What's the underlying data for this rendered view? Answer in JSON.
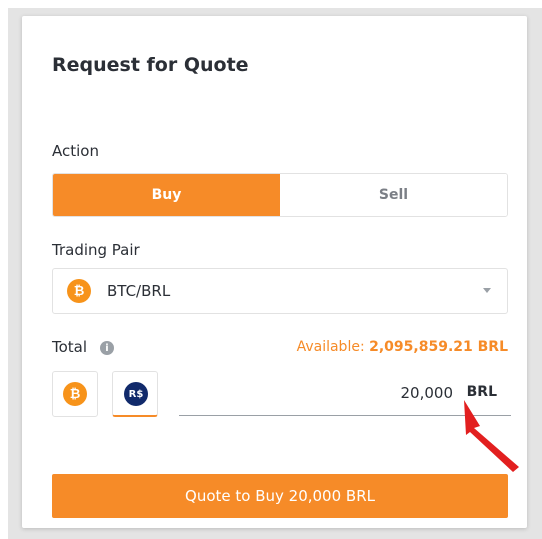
{
  "title": "Request for Quote",
  "action": {
    "label": "Action",
    "options": [
      "Buy",
      "Sell"
    ],
    "selected": "Buy"
  },
  "trading_pair": {
    "label": "Trading Pair",
    "value": "BTC/BRL",
    "coin_icon": "bitcoin-icon",
    "coin_symbol": "₿"
  },
  "total": {
    "label": "Total",
    "info_icon": "i",
    "available_prefix": "Available:",
    "available_amount": "2,095,859.21 BRL",
    "currency_buttons": [
      {
        "name": "bitcoin-currency",
        "symbol": "₿"
      },
      {
        "name": "brl-currency",
        "symbol": "R$"
      }
    ],
    "amount": "20,000",
    "unit": "BRL"
  },
  "quote_button": "Quote to Buy 20,000 BRL",
  "colors": {
    "accent": "#f68b28",
    "annotation_arrow": "#e21f1f",
    "bitcoin": "#f7931a",
    "brl": "#112a6b"
  }
}
